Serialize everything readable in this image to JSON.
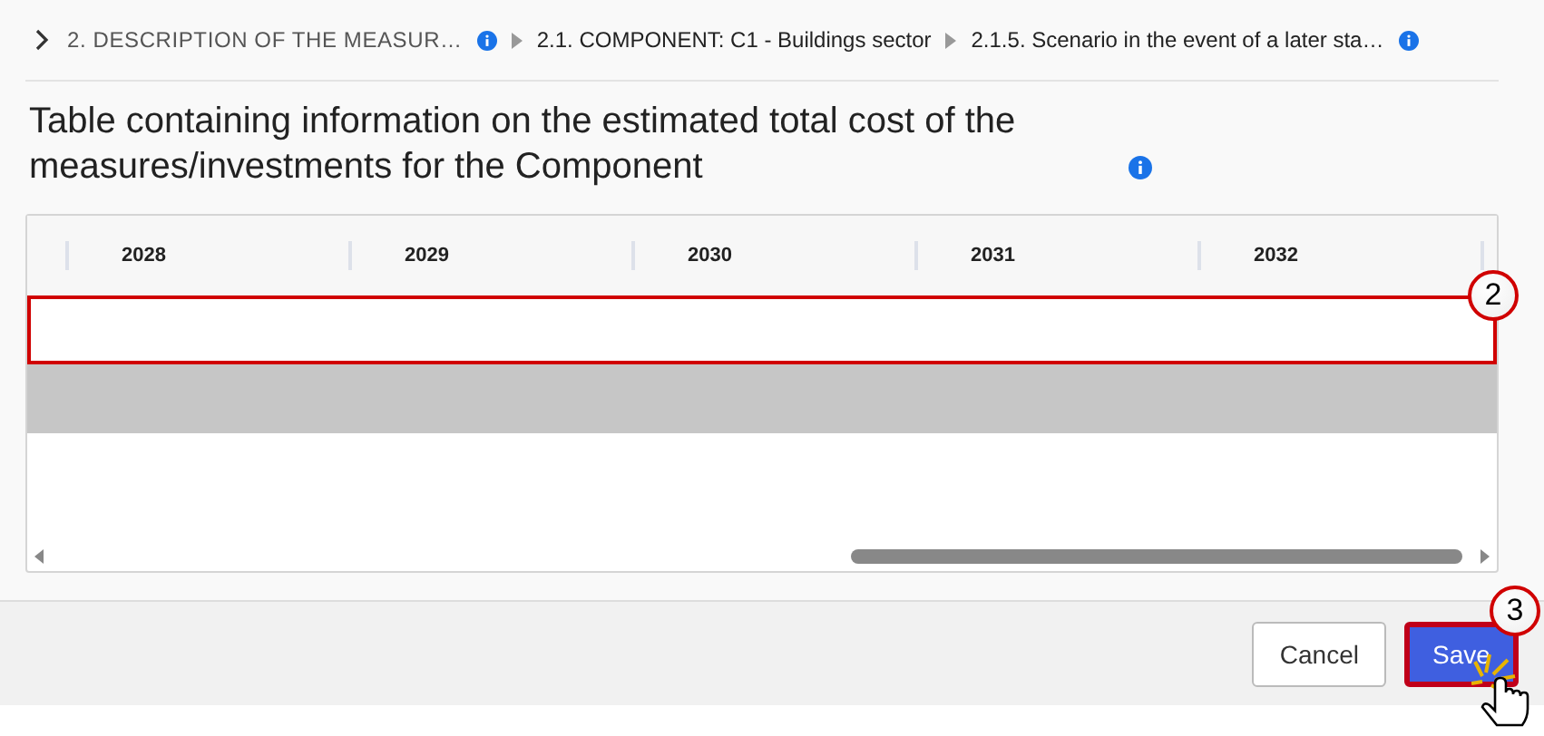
{
  "breadcrumb": [
    {
      "label": "2. DESCRIPTION OF THE MEASUR…",
      "info": true,
      "muted": true
    },
    {
      "label": "2.1. COMPONENT: C1 - Buildings sector",
      "info": false,
      "muted": false
    },
    {
      "label": "2.1.5. Scenario in the event of a later sta…",
      "info": true,
      "muted": false
    }
  ],
  "title": "Table containing information on the estimated total cost of the measures/investments for the Component",
  "table": {
    "columns": [
      "2028",
      "2029",
      "2030",
      "2031",
      "2032"
    ],
    "rows": [
      {
        "kind": "highlighted",
        "callout": "2"
      },
      {
        "kind": "grey"
      }
    ]
  },
  "buttons": [
    {
      "label": "Cancel",
      "kind": "secondary"
    },
    {
      "label": "Save",
      "kind": "primary",
      "callout": "3"
    }
  ]
}
